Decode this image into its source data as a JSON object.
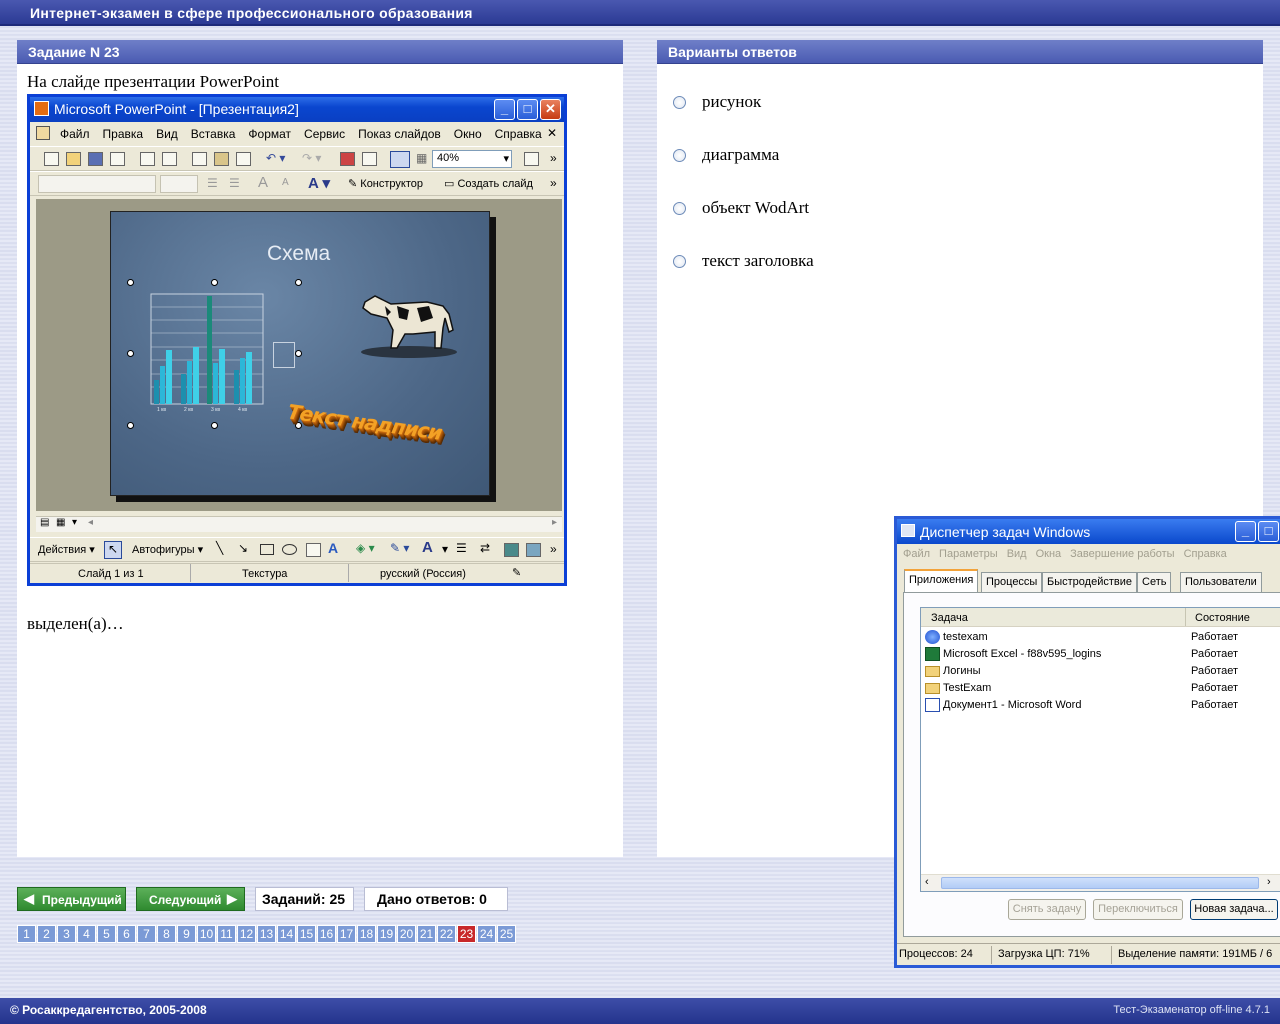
{
  "header": {
    "title": "Интернет-экзамен в сфере профессионального образования"
  },
  "question": {
    "panel_title": "Задание N 23",
    "text_before": "На слайде презентации PowerPoint",
    "text_after": "выделен(а)…",
    "powerpoint": {
      "title": "Microsoft PowerPoint - [Презентация2]",
      "menu": [
        "Файл",
        "Правка",
        "Вид",
        "Вставка",
        "Формат",
        "Сервис",
        "Показ слайдов",
        "Окно",
        "Справка"
      ],
      "zoom": "40%",
      "constructor_label": "Конструктор",
      "create_slide_label": "Создать слайд",
      "slide_title": "Схема",
      "wordart_text": "Текст надписи",
      "chart_categories": [
        "1 кв",
        "2 кв",
        "3 кв",
        "4 кв"
      ],
      "actions_label": "Действия",
      "autoshapes_label": "Автофигуры",
      "status_slide": "Слайд 1 из 1",
      "status_design": "Текстура",
      "status_language": "русский (Россия)"
    }
  },
  "answers": {
    "panel_title": "Варианты ответов",
    "options": [
      "рисунок",
      "диаграмма",
      "объект WodArt",
      "текст заголовка"
    ]
  },
  "navigation": {
    "prev_label": "Предыдущий",
    "next_label": "Следующий",
    "tasks_count": "Заданий: 25",
    "answers_given": "Дано ответов: 0",
    "pages": [
      "1",
      "2",
      "3",
      "4",
      "5",
      "6",
      "7",
      "8",
      "9",
      "10",
      "11",
      "12",
      "13",
      "14",
      "15",
      "16",
      "17",
      "18",
      "19",
      "20",
      "21",
      "22",
      "23",
      "24",
      "25"
    ],
    "current_page": "23"
  },
  "task_manager": {
    "title": "Диспетчер задач Windows",
    "menu": [
      "Файл",
      "Параметры",
      "Вид",
      "Окна",
      "Завершение работы",
      "Справка"
    ],
    "tabs": [
      "Приложения",
      "Процессы",
      "Быстродействие",
      "Сеть",
      "Пользователи"
    ],
    "columns": [
      "Задача",
      "Состояние"
    ],
    "rows": [
      {
        "name": "testexam",
        "status": "Работает",
        "icon": "globe-icon"
      },
      {
        "name": "Microsoft Excel - f88v595_logins",
        "status": "Работает",
        "icon": "excel-icon"
      },
      {
        "name": "Логины",
        "status": "Работает",
        "icon": "folder-icon"
      },
      {
        "name": "TestExam",
        "status": "Работает",
        "icon": "folder-icon"
      },
      {
        "name": "Документ1 - Microsoft Word",
        "status": "Работает",
        "icon": "word-icon"
      }
    ],
    "buttons": {
      "end_task": "Снять задачу",
      "switch_to": "Переключиться",
      "new_task": "Новая задача..."
    },
    "status": {
      "processes": "Процессов: 24",
      "cpu": "Загрузка ЦП: 71%",
      "memory": "Выделение памяти: 191МБ / 6"
    }
  },
  "footer": {
    "copyright": "© Росаккредагентство, 2005-2008",
    "version": "Тест-Экзаменатор off-line 4.7.1"
  },
  "colors": {
    "accent": "#2b3a94",
    "next_button": "#3a943a",
    "current_page": "#c8282a",
    "xp_title": "#0a46cf"
  }
}
